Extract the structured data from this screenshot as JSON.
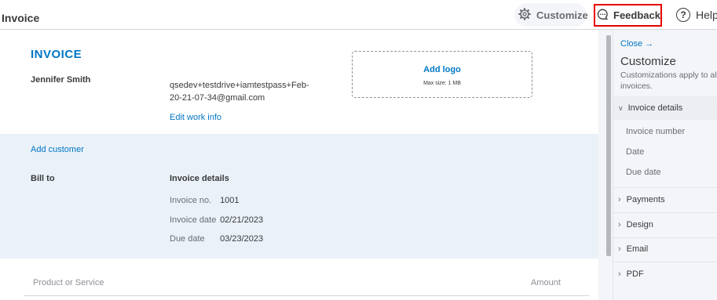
{
  "header": {
    "title": "Invoice",
    "customize_label": "Customize",
    "feedback_label": "Feedback",
    "help_label": "Help",
    "help_symbol": "?"
  },
  "invoice": {
    "heading": "INVOICE",
    "company_name": "Jennifer Smith",
    "email": "qsedev+testdrive+iamtestpass+Feb-20-21-07-34@gmail.com",
    "edit_work_info": "Edit work info",
    "logo": {
      "title": "Add logo",
      "subtitle": "Max size: 1 MB"
    },
    "add_customer": "Add customer",
    "bill_to": "Bill to",
    "details": {
      "title": "Invoice details",
      "rows": [
        {
          "label": "Invoice no.",
          "value": "1001"
        },
        {
          "label": "Invoice date",
          "value": "02/21/2023"
        },
        {
          "label": "Due date",
          "value": "03/23/2023"
        }
      ]
    },
    "table": {
      "col_product": "Product or Service",
      "col_amount": "Amount"
    }
  },
  "panel": {
    "close_label": "Close →",
    "title": "Customize",
    "description": "Customizations apply to all invoices.",
    "sections": [
      {
        "label": "Invoice details",
        "expanded": true,
        "items": [
          "Invoice number",
          "Date",
          "Due date"
        ]
      },
      {
        "label": "Payments",
        "expanded": false
      },
      {
        "label": "Design",
        "expanded": false
      },
      {
        "label": "Email",
        "expanded": false
      },
      {
        "label": "PDF",
        "expanded": false
      }
    ]
  },
  "colors": {
    "accent": "#0077c5",
    "band": "#eaf1f8",
    "highlight_border": "#e60000"
  },
  "icons": {
    "customize": "gear-icon",
    "feedback": "chat-bubble-icon",
    "help": "help-circle-icon"
  }
}
